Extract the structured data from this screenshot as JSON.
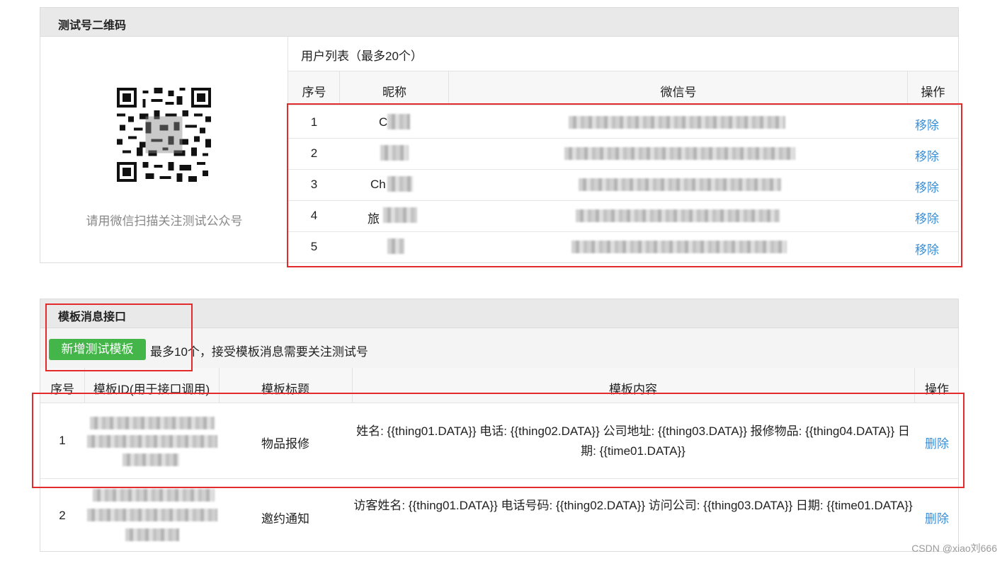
{
  "qr_panel": {
    "title": "测试号二维码",
    "caption": "请用微信扫描关注测试公众号"
  },
  "user_list": {
    "title": "用户列表（最多20个）",
    "headers": [
      "序号",
      "昵称",
      "微信号",
      "操作"
    ],
    "rows": [
      {
        "index": "1",
        "nickname": "C",
        "wechat_id": "",
        "action": "移除"
      },
      {
        "index": "2",
        "nickname": "",
        "wechat_id": "",
        "action": "移除"
      },
      {
        "index": "3",
        "nickname": "Ch",
        "wechat_id": "",
        "action": "移除"
      },
      {
        "index": "4",
        "nickname": "旅",
        "wechat_id": "",
        "action": "移除"
      },
      {
        "index": "5",
        "nickname": "",
        "wechat_id": "",
        "action": "移除"
      }
    ]
  },
  "template_panel": {
    "title": "模板消息接口",
    "add_button": "新增测试模板",
    "note": "最多10个，接受模板消息需要关注测试号",
    "headers": [
      "序号",
      "模板ID(用于接口调用)",
      "模板标题",
      "模板内容",
      "操作"
    ],
    "rows": [
      {
        "index": "1",
        "title": "物品报修",
        "content": "姓名: {{thing01.DATA}} 电话: {{thing02.DATA}} 公司地址: {{thing03.DATA}} 报修物品: {{thing04.DATA}} 日期: {{time01.DATA}}",
        "action": "删除"
      },
      {
        "index": "2",
        "title": "邀约通知",
        "content": "访客姓名: {{thing01.DATA}} 电话号码: {{thing02.DATA}} 访问公司: {{thing03.DATA}} 日期: {{time01.DATA}}",
        "action": "删除"
      }
    ]
  },
  "watermark": "CSDN @xiao刘666",
  "colors": {
    "accent_green": "#44b549",
    "link_blue": "#3a8fd8",
    "highlight_red": "#e32b2b"
  }
}
